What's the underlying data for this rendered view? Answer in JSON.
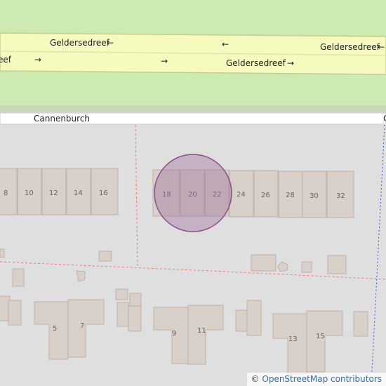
{
  "map": {
    "streets": {
      "main_top_left": "Geldersedreef",
      "main_top_right": "Geldersedreef",
      "main_bottom_left": "eef",
      "main_bottom_mid": "Geldersedreef",
      "side": "Cannenburch",
      "side_edge": "C"
    },
    "arrows": {
      "left": "←",
      "right": "→"
    },
    "house_numbers": {
      "row1": [
        "8",
        "10",
        "12",
        "14",
        "16"
      ],
      "row2": [
        "18",
        "20",
        "22",
        "24",
        "26",
        "28",
        "30",
        "32"
      ],
      "row3": [
        "5",
        "7",
        "9",
        "11",
        "13",
        "15"
      ]
    },
    "highlight_color": "#9c6b9c",
    "land_colors": {
      "grass": "#cdebb0",
      "residential": "#e0dfdf",
      "building": "#d9d0c9",
      "road_primary": "#f7fabf"
    }
  },
  "attribution": {
    "copy": "©",
    "link": "OpenStreetMap contributors"
  }
}
